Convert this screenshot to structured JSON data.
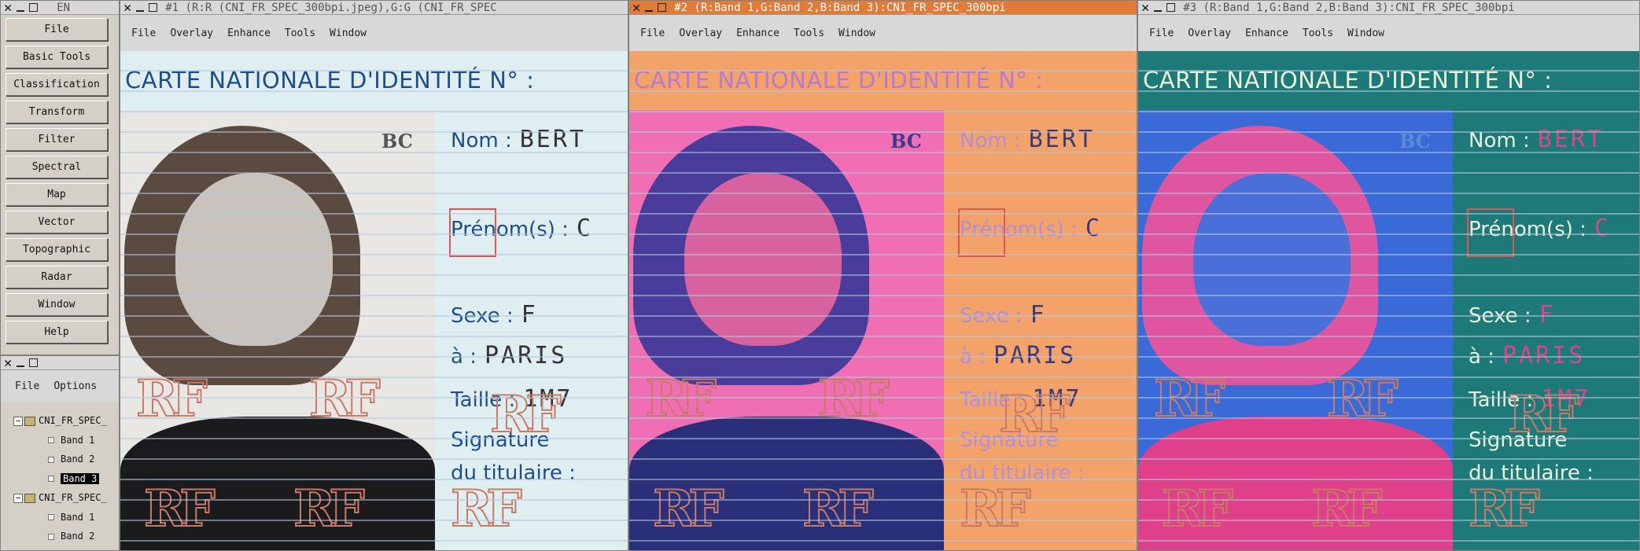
{
  "main_menu": {
    "title": "EN",
    "buttons": [
      "File",
      "Basic Tools",
      "Classification",
      "Transform",
      "Filter",
      "Spectral",
      "Map",
      "Vector",
      "Topographic",
      "Radar",
      "Window",
      "Help"
    ]
  },
  "layer_manager": {
    "menu": [
      "File",
      "Options"
    ],
    "tree": [
      {
        "label": "CNI_FR_SPEC_",
        "type": "file"
      },
      {
        "label": "Band 1",
        "type": "band"
      },
      {
        "label": "Band 2",
        "type": "band"
      },
      {
        "label": "Band 3",
        "type": "band",
        "selected": true
      },
      {
        "label": "CNI_FR_SPEC_",
        "type": "file"
      },
      {
        "label": "Band 1",
        "type": "band"
      },
      {
        "label": "Band 2",
        "type": "band"
      }
    ]
  },
  "viewers": [
    {
      "title": "#1 (R:R (CNI_FR_SPEC_300bpi.jpeg),G:G (CNI_FR_SPEC",
      "active": false
    },
    {
      "title": "#2 (R:Band 1,G:Band 2,B:Band 3):CNI_FR_SPEC_300bpi",
      "active": true
    },
    {
      "title": "#3 (R:Band 1,G:Band 2,B:Band 3):CNI_FR_SPEC_300bpi",
      "active": false
    }
  ],
  "viewer_menu": [
    "File",
    "Overlay",
    "Enhance",
    "Tools",
    "Window"
  ],
  "card": {
    "header": "CARTE NATIONALE D'IDENTITÉ N° :",
    "bc": "BC",
    "nom_label": "Nom :",
    "nom_value": "BERT",
    "prenom_label": "Prénom(s) :",
    "prenom_value": "C",
    "sexe_label": "Sexe :",
    "sexe_value": "F",
    "a_label": "à :",
    "a_value": "PARIS",
    "taille_label": "Taille :",
    "taille_value": "1M7",
    "signature_label": "Signature",
    "signature_label2": "du titulaire :",
    "watermark": "RF"
  },
  "palettes": {
    "v1": {
      "bg": "#dfeef0",
      "header": "#1f4f8a",
      "field": "#1f4f8a",
      "value": "#333333",
      "photo_bg": "#e9e7e3",
      "hair": "#5a4a40",
      "face": "#c9c3bd",
      "clothes": "#1b1b1e",
      "bc": "#555555"
    },
    "v2": {
      "bg": "#f3a36a",
      "header": "#b87bd0",
      "field": "#b08fd8",
      "value": "#3a3a7a",
      "photo_bg": "#f06fb4",
      "hair": "#4a3c9a",
      "face": "#d7629f",
      "clothes": "#2a2f7a",
      "bc": "#3a3a8a"
    },
    "v3": {
      "bg": "#1d7a78",
      "header": "#e8f0d8",
      "field": "#e8f2dc",
      "value": "#d04a8a",
      "photo_bg": "#3a6ad8",
      "hair": "#e0559f",
      "face": "#4a6fd8",
      "clothes": "#e03f8a",
      "bc": "#5a8ad8"
    }
  }
}
